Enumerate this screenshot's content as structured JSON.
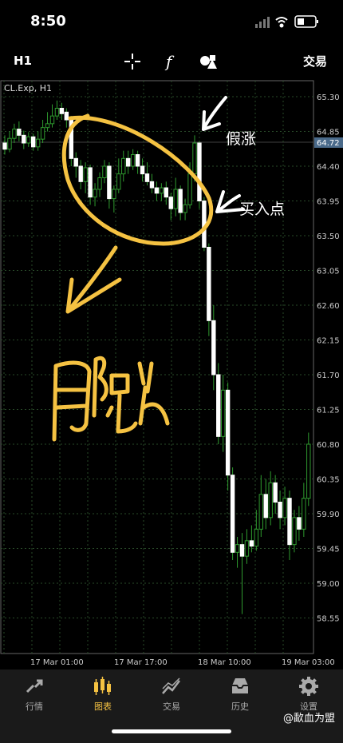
{
  "status": {
    "time": "8:50"
  },
  "toolbar": {
    "timeframe": "H1",
    "trade_label": "交易"
  },
  "chart": {
    "symbol": "CL.Exp, H1",
    "current_price": "64.72",
    "price_labels": [
      "65.30",
      "64.85",
      "64.40",
      "63.95",
      "63.50",
      "63.05",
      "62.60",
      "62.15",
      "61.70",
      "61.25",
      "60.80",
      "60.35",
      "59.90",
      "59.45",
      "59.00",
      "58.55"
    ],
    "time_labels": [
      "17 Mar 01:00",
      "17 Mar 17:00",
      "18 Mar 10:00",
      "19 Mar 03:00"
    ],
    "annotations": {
      "fake_rise": "假涨",
      "buy_point": "买入点",
      "bearish_fall": "阴跌"
    }
  },
  "tabs": [
    {
      "label": "行情",
      "icon": "quotes-icon"
    },
    {
      "label": "图表",
      "icon": "chart-icon",
      "active": true
    },
    {
      "label": "交易",
      "icon": "trade-icon"
    },
    {
      "label": "历史",
      "icon": "history-icon"
    },
    {
      "label": "设置",
      "icon": "settings-icon"
    }
  ],
  "watermark": "@歃血为盟",
  "colors": {
    "accent": "#f5c242",
    "grid": "#2f4f2f",
    "bull": "#ffffff",
    "bear": "#ffffff"
  }
}
